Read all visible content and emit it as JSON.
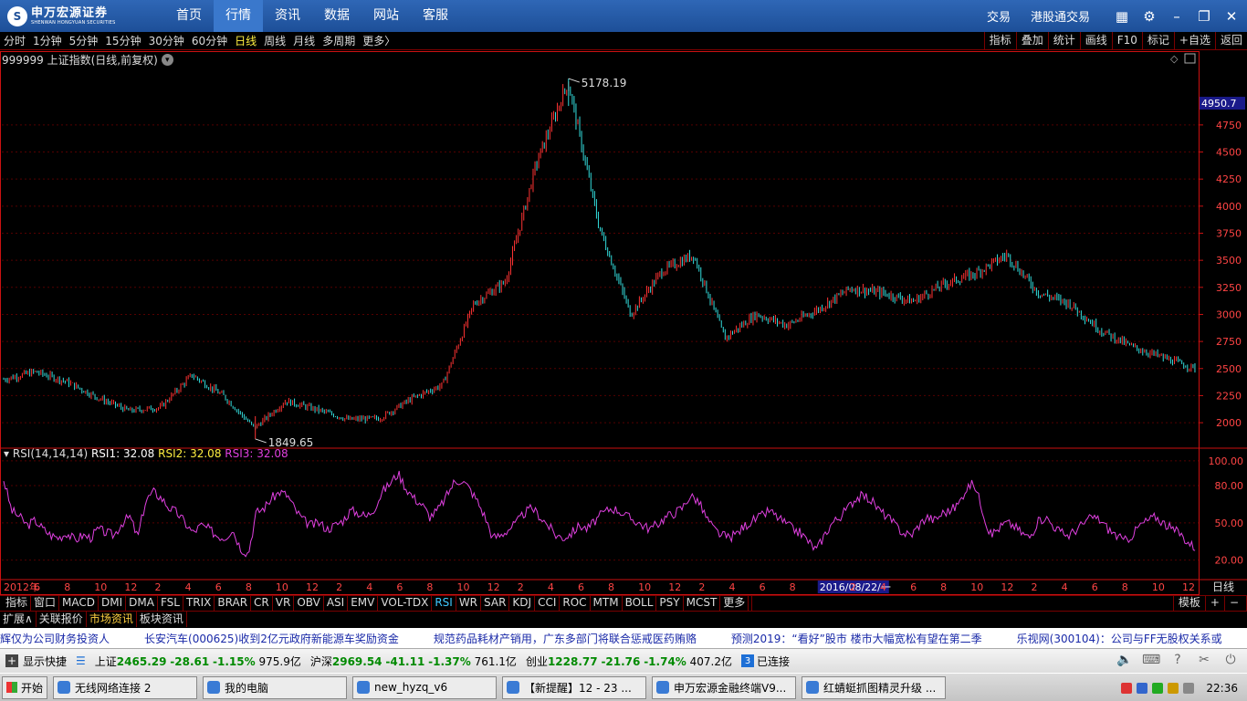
{
  "app": {
    "logo_main": "申万宏源证券",
    "logo_sub": "SHENWAN HONGYUAN SECURITIES",
    "nav": [
      "首页",
      "行情",
      "资讯",
      "数据",
      "网站",
      "客服"
    ],
    "nav_active": "行情",
    "right_links": [
      "交易",
      "港股通交易"
    ]
  },
  "periods": {
    "items": [
      "分时",
      "1分钟",
      "5分钟",
      "15分钟",
      "30分钟",
      "60分钟",
      "日线",
      "周线",
      "月线",
      "多周期",
      "更多〉"
    ],
    "active": "日线",
    "tools": [
      "指标",
      "叠加",
      "统计",
      "画线",
      "F10",
      "标记",
      "+自选",
      "返回"
    ]
  },
  "chart_header": {
    "title": "999999 上证指数(日线,前复权)",
    "cursor_price": "4950.7"
  },
  "chart_data": [
    {
      "type": "candlestick",
      "title": "999999 上证指数(日线,前复权)",
      "y_ticks": [
        2000,
        2250,
        2500,
        2750,
        3000,
        3250,
        3500,
        3750,
        4000,
        4250,
        4500,
        4750
      ],
      "ylim": [
        1790,
        5280
      ],
      "high_label": "5178.19",
      "low_label": "1849.65",
      "trend": [
        {
          "x": "2012-01",
          "y": 2400
        },
        {
          "x": "2012-03",
          "y": 2470
        },
        {
          "x": "2012-05",
          "y": 2380
        },
        {
          "x": "2012-07",
          "y": 2230
        },
        {
          "x": "2012-09",
          "y": 2110
        },
        {
          "x": "2012-12",
          "y": 2140
        },
        {
          "x": "2013-02",
          "y": 2440
        },
        {
          "x": "2013-04",
          "y": 2250
        },
        {
          "x": "2013-06",
          "y": 1950
        },
        {
          "x": "2013-09",
          "y": 2200
        },
        {
          "x": "2013-12",
          "y": 2120
        },
        {
          "x": "2014-03",
          "y": 2030
        },
        {
          "x": "2014-06",
          "y": 2040
        },
        {
          "x": "2014-08",
          "y": 2220
        },
        {
          "x": "2014-10",
          "y": 2350
        },
        {
          "x": "2014-12",
          "y": 3100
        },
        {
          "x": "2015-02",
          "y": 3300
        },
        {
          "x": "2015-04",
          "y": 4400
        },
        {
          "x": "2015-06",
          "y": 5150
        },
        {
          "x": "2015-07",
          "y": 3800
        },
        {
          "x": "2015-08",
          "y": 3000
        },
        {
          "x": "2015-10",
          "y": 3400
        },
        {
          "x": "2015-12",
          "y": 3550
        },
        {
          "x": "2016-01",
          "y": 2780
        },
        {
          "x": "2016-03",
          "y": 3000
        },
        {
          "x": "2016-06",
          "y": 2900
        },
        {
          "x": "2016-09",
          "y": 3050
        },
        {
          "x": "2016-11",
          "y": 3240
        },
        {
          "x": "2017-02",
          "y": 3200
        },
        {
          "x": "2017-05",
          "y": 3120
        },
        {
          "x": "2017-08",
          "y": 3280
        },
        {
          "x": "2017-11",
          "y": 3380
        },
        {
          "x": "2018-01",
          "y": 3550
        },
        {
          "x": "2018-02",
          "y": 3200
        },
        {
          "x": "2018-04",
          "y": 3100
        },
        {
          "x": "2018-06",
          "y": 2850
        },
        {
          "x": "2018-08",
          "y": 2700
        },
        {
          "x": "2018-10",
          "y": 2600
        },
        {
          "x": "2018-12",
          "y": 2500
        }
      ]
    },
    {
      "type": "line",
      "title": "RSI(14,14,14)",
      "series": [
        {
          "name": "RSI1",
          "value_label": "32.08",
          "color": "#ffffff"
        },
        {
          "name": "RSI2",
          "value_label": "32.08",
          "color": "#ffef40"
        },
        {
          "name": "RSI3",
          "value_label": "32.08",
          "color": "#e040e0"
        }
      ],
      "y_ticks": [
        "20.00",
        "50.00",
        "80.00",
        "100.00"
      ],
      "ylim": [
        5,
        108
      ],
      "values": [
        85,
        60,
        55,
        48,
        52,
        45,
        40,
        38,
        42,
        36,
        40,
        38,
        45,
        42,
        40,
        50,
        55,
        38,
        68,
        75,
        70,
        62,
        58,
        50,
        42,
        48,
        45,
        40,
        38,
        45,
        30,
        25,
        58,
        62,
        70,
        75,
        72,
        60,
        52,
        48,
        50,
        45,
        48,
        52,
        60,
        58,
        55,
        62,
        75,
        82,
        90,
        78,
        70,
        65,
        55,
        60,
        70,
        82,
        85,
        78,
        68,
        55,
        38,
        40,
        45,
        50,
        58,
        62,
        55,
        48,
        40,
        38,
        42,
        48,
        45,
        52,
        58,
        62,
        60,
        55,
        52,
        48,
        45,
        50,
        55,
        58,
        62,
        72,
        68,
        55,
        45,
        40,
        38,
        42,
        48,
        52,
        55,
        60,
        55,
        50,
        45,
        42,
        35,
        28,
        40,
        50,
        55,
        62,
        70,
        72,
        68,
        60,
        55,
        48,
        42,
        40,
        48,
        55,
        52,
        58,
        60,
        65,
        78,
        82,
        62,
        40,
        45,
        50,
        48,
        42,
        38,
        50,
        55,
        48,
        42,
        40,
        45,
        50,
        55,
        52,
        45,
        40,
        35,
        40,
        48,
        52,
        55,
        50,
        45,
        42,
        35,
        30
      ]
    }
  ],
  "x_axis": {
    "labels": [
      "2012年",
      "6",
      "8",
      "10",
      "12",
      "2",
      "4",
      "6",
      "8",
      "10",
      "12",
      "2",
      "4",
      "6",
      "8",
      "10",
      "12",
      "2",
      "4",
      "6",
      "8",
      "10",
      "12",
      "2",
      "4",
      "6",
      "8",
      "2016/08/22/一",
      "2",
      "4",
      "6",
      "8",
      "10",
      "12",
      "2",
      "4",
      "6",
      "8",
      "10",
      "12"
    ],
    "period": "日线"
  },
  "indicator_tabs": {
    "items": [
      "指标",
      "窗口",
      "MACD",
      "DMI",
      "DMA",
      "FSL",
      "TRIX",
      "BRAR",
      "CR",
      "VR",
      "OBV",
      "ASI",
      "EMV",
      "VOL-TDX",
      "RSI",
      "WR",
      "SAR",
      "KDJ",
      "CCI",
      "ROC",
      "MTM",
      "BOLL",
      "PSY",
      "MCST",
      "更多"
    ],
    "active": "RSI",
    "right": [
      "模板",
      "+",
      "−"
    ]
  },
  "extra_tabs": {
    "items": [
      "扩展∧",
      "关联报价",
      "市场资讯",
      "板块资讯"
    ],
    "active": "市场资讯"
  },
  "ticker": [
    "辉仅为公司财务投资人",
    "长安汽车(000625)收到2亿元政府新能源车奖励资金",
    "规范药品耗材产销用，广东多部门将联合惩戒医药贿赂",
    "预测2019：“看好”股市 楼市大幅宽松有望在第二季",
    "乐视网(300104)：公司与FF无股权关系或"
  ],
  "status": {
    "show_quick": "显示快捷",
    "indices": [
      {
        "name": "上证",
        "price": "2465.29",
        "chg": "-28.61",
        "pct": "-1.15%",
        "vol": "975.9亿"
      },
      {
        "name": "沪深",
        "price": "2969.54",
        "chg": "-41.11",
        "pct": "-1.37%",
        "vol": "761.1亿"
      },
      {
        "name": "创业",
        "price": "1228.77",
        "chg": "-21.76",
        "pct": "-1.74%",
        "vol": "407.2亿"
      }
    ],
    "conn_count": "3",
    "conn_text": "已连接"
  },
  "taskbar": {
    "start": "开始",
    "tasks": [
      "无线网络连接 2",
      "我的电脑",
      "new_hyzq_v6",
      "【新提醒】12 - 23 ...",
      "申万宏源金融终端V9...",
      "红蜻蜓抓图精灵升级 ..."
    ],
    "clock": "22:36"
  },
  "colors": {
    "up": "#ff3333",
    "down": "#33dddd",
    "rsi": "#e040e0",
    "axis_red": "#cc1111",
    "grid": "#550000"
  }
}
